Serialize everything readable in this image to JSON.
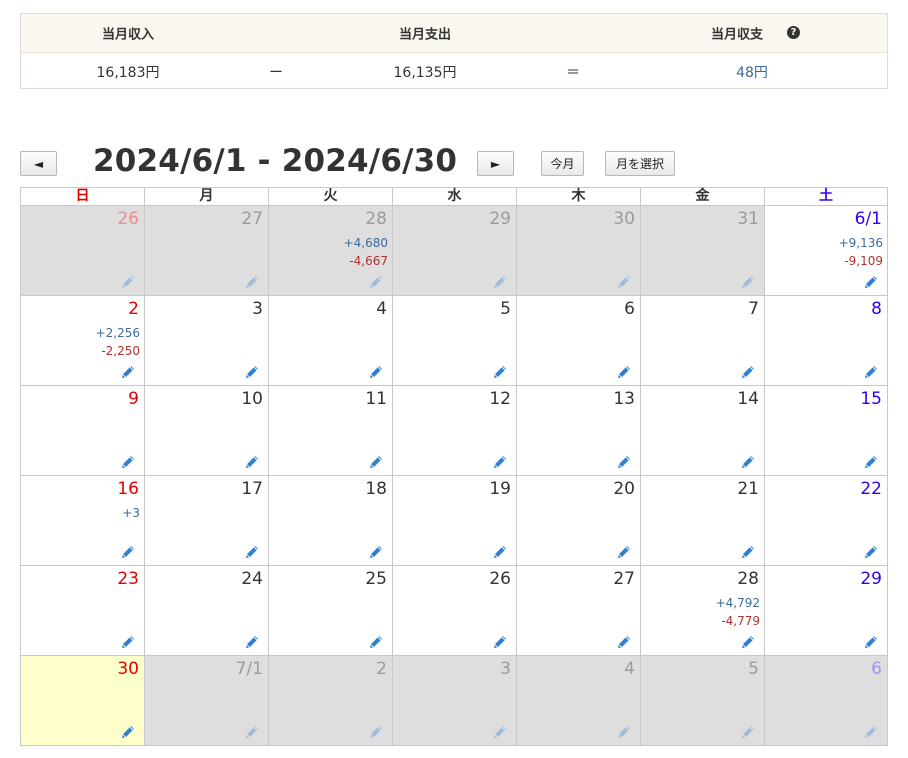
{
  "summary": {
    "income_label": "当月収入",
    "expense_label": "当月支出",
    "balance_label": "当月収支",
    "income_value": "16,183円",
    "minus_sign": "ー",
    "expense_value": "16,135円",
    "equals_sign": "＝",
    "balance_value": "48円",
    "help_icon": "question-circle-icon"
  },
  "nav": {
    "prev_label": "◄",
    "range_title": "2024/6/1 - 2024/6/30",
    "next_label": "►",
    "today_label": "今月",
    "select_month_label": "月を選択"
  },
  "calendar": {
    "weekdays": [
      "日",
      "月",
      "火",
      "水",
      "木",
      "金",
      "土"
    ],
    "edit_icon": "pencil-icon",
    "colors": {
      "sunday": "#e30000",
      "saturday": "#3300ee",
      "income": "#3d6a9c",
      "expense": "#b03030",
      "today_bg": "#ffffcc",
      "other_month_bg": "#dedede"
    },
    "weeks": [
      [
        {
          "day": "26",
          "other": true
        },
        {
          "day": "27",
          "other": true
        },
        {
          "day": "28",
          "other": true,
          "income": "+4,680",
          "expense": "-4,667"
        },
        {
          "day": "29",
          "other": true
        },
        {
          "day": "30",
          "other": true
        },
        {
          "day": "31",
          "other": true
        },
        {
          "day": "6/1",
          "income": "+9,136",
          "expense": "-9,109"
        }
      ],
      [
        {
          "day": "2",
          "income": "+2,256",
          "expense": "-2,250"
        },
        {
          "day": "3"
        },
        {
          "day": "4"
        },
        {
          "day": "5"
        },
        {
          "day": "6"
        },
        {
          "day": "7"
        },
        {
          "day": "8"
        }
      ],
      [
        {
          "day": "9"
        },
        {
          "day": "10"
        },
        {
          "day": "11"
        },
        {
          "day": "12"
        },
        {
          "day": "13"
        },
        {
          "day": "14"
        },
        {
          "day": "15"
        }
      ],
      [
        {
          "day": "16",
          "income": "+3"
        },
        {
          "day": "17"
        },
        {
          "day": "18"
        },
        {
          "day": "19"
        },
        {
          "day": "20"
        },
        {
          "day": "21"
        },
        {
          "day": "22"
        }
      ],
      [
        {
          "day": "23"
        },
        {
          "day": "24"
        },
        {
          "day": "25"
        },
        {
          "day": "26"
        },
        {
          "day": "27"
        },
        {
          "day": "28",
          "income": "+4,792",
          "expense": "-4,779"
        },
        {
          "day": "29"
        }
      ],
      [
        {
          "day": "30",
          "today": true
        },
        {
          "day": "7/1",
          "other": true
        },
        {
          "day": "2",
          "other": true
        },
        {
          "day": "3",
          "other": true
        },
        {
          "day": "4",
          "other": true
        },
        {
          "day": "5",
          "other": true
        },
        {
          "day": "6",
          "other": true
        }
      ]
    ]
  }
}
